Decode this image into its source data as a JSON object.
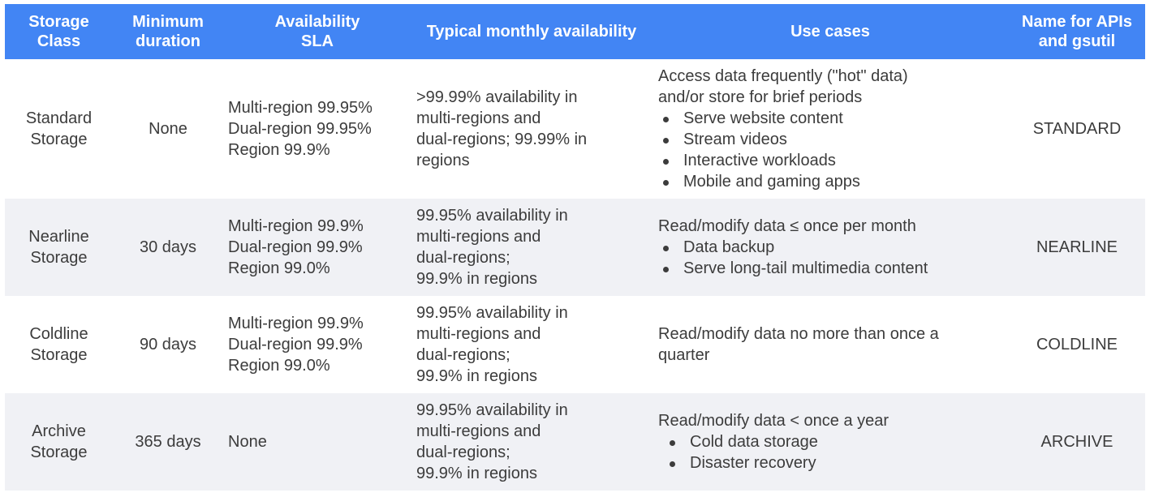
{
  "header": {
    "storage_class": [
      "Storage",
      "Class"
    ],
    "minimum_duration": [
      "Minimum",
      "duration"
    ],
    "availability_sla": [
      "Availability",
      "SLA"
    ],
    "typical_monthly": [
      "Typical monthly availability"
    ],
    "use_cases": [
      "Use cases"
    ],
    "api_name": [
      "Name for APIs",
      "and gsutil"
    ]
  },
  "rows": [
    {
      "storage_class": [
        "Standard",
        "Storage"
      ],
      "minimum_duration": [
        "None"
      ],
      "availability_sla": [
        "Multi-region 99.95%",
        "Dual-region 99.95%",
        "Region 99.9%"
      ],
      "typical_monthly": [
        ">99.99% availability in",
        "multi-regions and",
        "dual-regions; 99.99% in",
        "regions"
      ],
      "use_cases_intro": [
        "Access data frequently (\"hot\" data)",
        "and/or store for brief periods"
      ],
      "use_cases_bullets": [
        "Serve website content",
        "Stream videos",
        "Interactive workloads",
        "Mobile and gaming apps"
      ],
      "api_name": "STANDARD"
    },
    {
      "storage_class": [
        "Nearline",
        "Storage"
      ],
      "minimum_duration": [
        "30 days"
      ],
      "availability_sla": [
        "Multi-region 99.9%",
        "Dual-region 99.9%",
        "Region 99.0%"
      ],
      "typical_monthly": [
        "99.95% availability in",
        "multi-regions and",
        "dual-regions;",
        "99.9% in regions"
      ],
      "use_cases_intro": [
        "Read/modify data ≤ once per month"
      ],
      "use_cases_bullets": [
        "Data backup",
        "Serve long-tail multimedia content"
      ],
      "api_name": "NEARLINE"
    },
    {
      "storage_class": [
        "Coldline",
        "Storage"
      ],
      "minimum_duration": [
        "90 days"
      ],
      "availability_sla": [
        "Multi-region 99.9%",
        "Dual-region 99.9%",
        "Region 99.0%"
      ],
      "typical_monthly": [
        "99.95% availability in",
        "multi-regions and",
        "dual-regions;",
        "99.9% in regions"
      ],
      "use_cases_intro": [
        "Read/modify data no more than once a",
        "quarter"
      ],
      "use_cases_bullets": [],
      "api_name": "COLDLINE"
    },
    {
      "storage_class": [
        "Archive",
        "Storage"
      ],
      "minimum_duration": [
        "365 days"
      ],
      "availability_sla": [
        "None"
      ],
      "typical_monthly": [
        "99.95% availability in",
        "multi-regions and",
        "dual-regions;",
        "99.9% in regions"
      ],
      "use_cases_intro": [
        "Read/modify data < once a year"
      ],
      "use_cases_bullets": [
        "Cold data storage",
        "Disaster recovery"
      ],
      "api_name": "ARCHIVE"
    }
  ]
}
